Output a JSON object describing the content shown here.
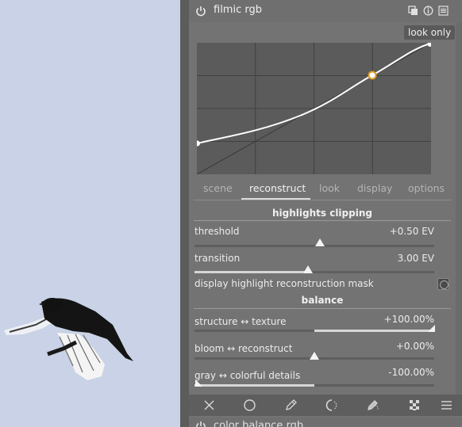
{
  "module": {
    "title": "filmic rgb",
    "badge": "look only"
  },
  "tabs": [
    "scene",
    "reconstruct",
    "look",
    "display",
    "options"
  ],
  "active_tab": "reconstruct",
  "sections": {
    "highlights": "highlights clipping",
    "balance": "balance"
  },
  "params": {
    "threshold": {
      "label": "threshold",
      "value": "+0.50 EV",
      "fraction": 0.55
    },
    "transition": {
      "label": "transition",
      "value": "3.00 EV",
      "fraction": 0.47
    },
    "mask": {
      "label": "display highlight reconstruction mask"
    },
    "structure": {
      "label": "structure ↔ texture",
      "value": "+100.00%",
      "fraction": 1.0
    },
    "bloom": {
      "label": "bloom ↔ reconstruct",
      "value": "+0.00%",
      "fraction": 0.5
    },
    "gray": {
      "label": "gray ↔ colorful details",
      "value": "-100.00%",
      "fraction": 0.0
    }
  },
  "bottom_icons": [
    "close-icon",
    "circle-icon",
    "pencil-icon",
    "brush-circle-icon",
    "pencil-parametric-icon",
    "checker-icon",
    "menu-icon"
  ],
  "next_module": {
    "title": "color balance rgb"
  },
  "colors": {
    "panel": "#737373",
    "accent_point": "#e0a020",
    "sky": "#c9d2e6"
  }
}
